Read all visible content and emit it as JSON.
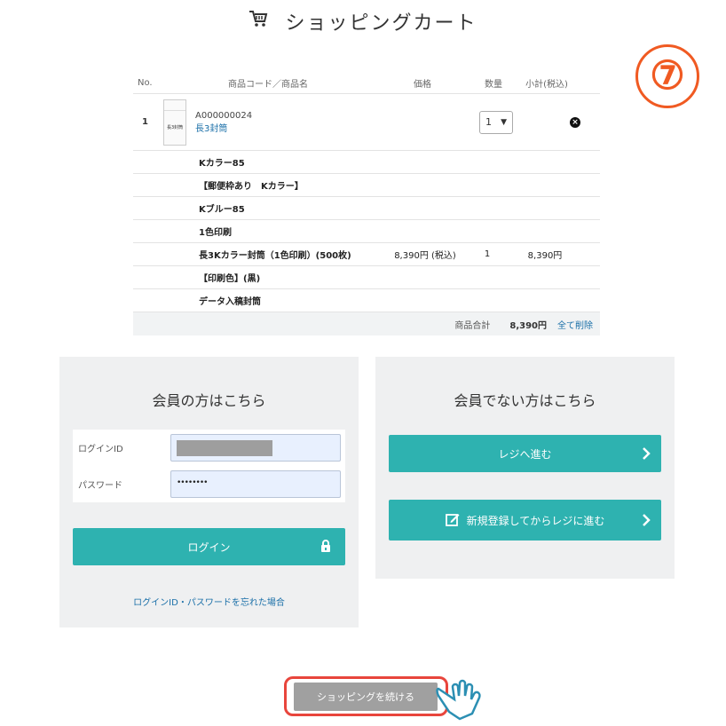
{
  "header": {
    "title": "ショッピングカート",
    "icon": "shopping-cart-icon"
  },
  "step_badge": "⑦",
  "cart": {
    "columns": {
      "no": "No.",
      "name": "商品コード／商品名",
      "price": "価格",
      "qty": "数量",
      "subtotal": "小計(税込)"
    },
    "item": {
      "no": "1",
      "code": "A000000024",
      "name": "長3封筒",
      "qty": "1",
      "thumb_label": "長3封筒"
    },
    "options": [
      {
        "name": "Kカラー85"
      },
      {
        "name": "【郵便枠あり　Kカラー】"
      },
      {
        "name": "Kブルー85"
      },
      {
        "name": "1色印刷"
      },
      {
        "name": "長3Kカラー封筒（1色印刷）(500枚)",
        "price": "8,390円 (税込)",
        "qty": "1",
        "subtotal": "8,390円"
      },
      {
        "name": "【印刷色】(黒)"
      },
      {
        "name": "データ入稿封筒"
      }
    ],
    "total": {
      "label": "商品合計",
      "value": "8,390円",
      "delete_all": "全て削除"
    }
  },
  "member": {
    "heading": "会員の方はこちら",
    "login_id_label": "ログインID",
    "password_label": "パスワード",
    "password_mask": "••••••••",
    "login_button": "ログイン",
    "forgot_link": "ログインID・パスワードを忘れた場合"
  },
  "guest": {
    "heading": "会員でない方はこちら",
    "checkout_button": "レジへ進む",
    "register_button": "新規登録してからレジに進む"
  },
  "continue_button": "ショッピングを続ける",
  "colors": {
    "teal": "#2eb2b0",
    "link": "#1a6fa8",
    "highlight": "#e8453c",
    "step": "#f05a22"
  }
}
